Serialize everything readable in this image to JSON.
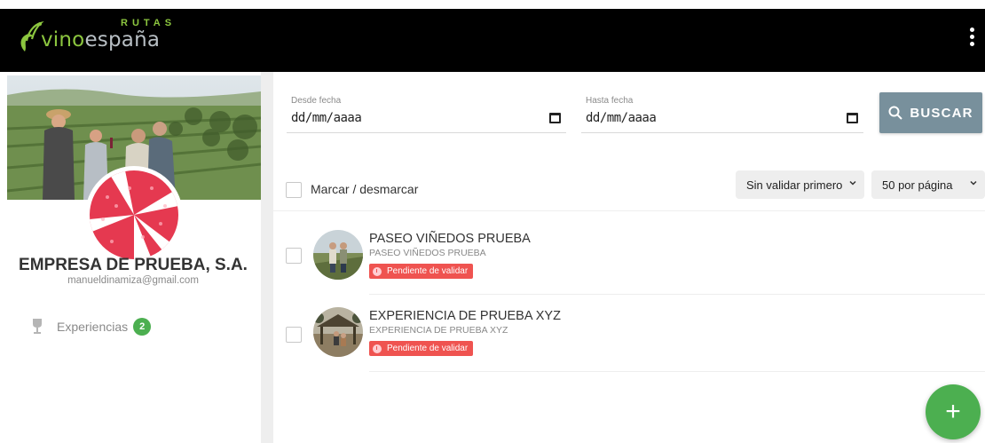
{
  "brand": {
    "part1": "vino",
    "part2": "españa",
    "rutas": "RUTAS"
  },
  "profile": {
    "company_name": "EMPRESA DE PRUEBA, S.A.",
    "email": "manueldinamiza@gmail.com"
  },
  "sidebar": {
    "items": [
      {
        "label": "Experiencias",
        "count": "2",
        "icon": "wine-glass-icon"
      }
    ]
  },
  "filters": {
    "from_label": "Desde fecha",
    "from_value": "dd/mm/aaaa",
    "to_label": "Hasta fecha",
    "to_value": "dd/mm/aaaa",
    "search_label": "BUSCAR"
  },
  "list": {
    "mark_label": "Marcar / desmarcar",
    "sort_value": "Sin validar primero",
    "page_size_value": "50 por página",
    "items": [
      {
        "title": "PASEO VIÑEDOS PRUEBA",
        "subtitle": "PASEO VIÑEDOS PRUEBA",
        "status": "Pendiente de validar"
      },
      {
        "title": "EXPERIENCIA DE PRUEBA XYZ",
        "subtitle": "EXPERIENCIA DE PRUEBA XYZ",
        "status": "Pendiente de validar"
      }
    ]
  },
  "colors": {
    "topbar": "#000000",
    "brand_green": "#8cc63f",
    "search_button": "#78909c",
    "status_red": "#ef5350",
    "badge_green": "#4caf50",
    "fab_green": "#4caf50"
  },
  "fab": {
    "label": "+"
  }
}
